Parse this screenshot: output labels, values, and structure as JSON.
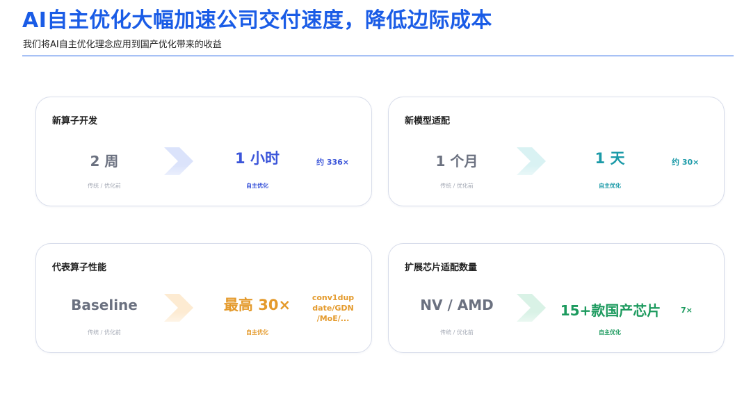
{
  "header": {
    "title": "AI自主优化大幅加速公司交付速度，降低边际成本",
    "subtitle": "我们将AI自主优化理念应用到国产优化带来的收益"
  },
  "cards": [
    {
      "title": "新算子开发",
      "before_value": "2 周",
      "before_caption": "传统 / 优化前",
      "after_value": "1 小时",
      "after_caption": "自主优化",
      "multiplier": "约 336×",
      "accent": "#3b55d9",
      "chevron": "#dbe3fb"
    },
    {
      "title": "新模型适配",
      "before_value": "1 个月",
      "before_caption": "传统 / 优化前",
      "after_value": "1 天",
      "after_caption": "自主优化",
      "multiplier": "约 30×",
      "accent": "#1b9aa8",
      "chevron": "#d9f2f3"
    },
    {
      "title": "代表算子性能",
      "before_value": "Baseline",
      "before_caption": "传统 / 优化前",
      "after_value": "最高 30×",
      "after_caption": "自主优化",
      "note": "conv1dup date/GDN /MoE/...",
      "accent": "#e49a2c",
      "chevron": "#fdebd2"
    },
    {
      "title": "扩展芯片适配数量",
      "before_value": "NV / AMD",
      "before_caption": "传统 / 优化前",
      "after_value": "15+款国产芯片",
      "after_caption": "自主优化",
      "multiplier": "7×",
      "accent": "#1c9a5e",
      "chevron": "#d9f2e6"
    }
  ]
}
